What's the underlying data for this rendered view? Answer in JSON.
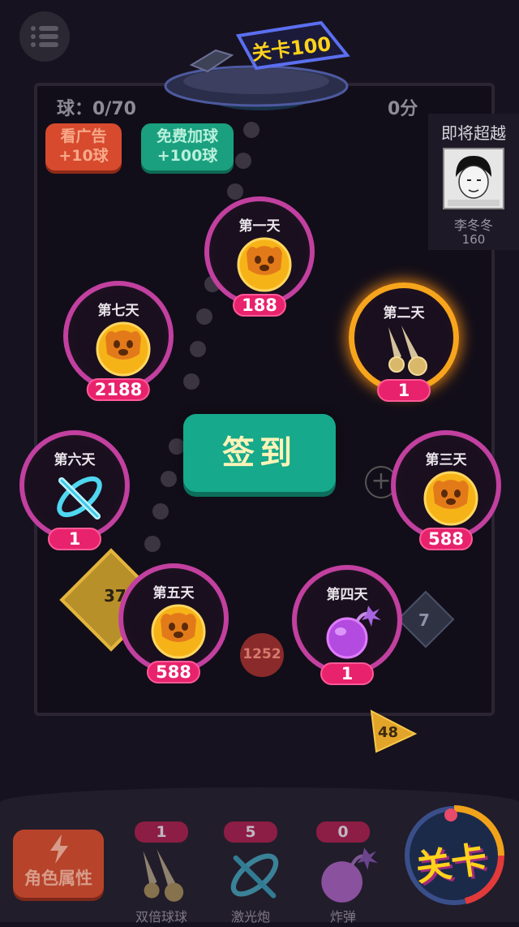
{
  "header": {
    "level_sign": "关卡100",
    "balls": "球：0/70",
    "score": "0分"
  },
  "actions": {
    "ad_line1": "看广告",
    "ad_line2": "+10球",
    "free_line1": "免费加球",
    "free_line2": "+100球"
  },
  "overtake": {
    "title": "即将超越",
    "name": "李冬冬",
    "score": "160"
  },
  "signin": {
    "button_label": "签到",
    "days": [
      {
        "label": "第一天",
        "reward": "188",
        "icon": "coin-face-icon"
      },
      {
        "label": "第二天",
        "reward": "1",
        "icon": "double-ball-icon",
        "highlighted": true
      },
      {
        "label": "第三天",
        "reward": "588",
        "icon": "coin-face-icon"
      },
      {
        "label": "第四天",
        "reward": "1",
        "icon": "bomb-icon"
      },
      {
        "label": "第五天",
        "reward": "588",
        "icon": "coin-face-icon"
      },
      {
        "label": "第六天",
        "reward": "1",
        "icon": "laser-icon"
      },
      {
        "label": "第七天",
        "reward": "2188",
        "icon": "coin-face-icon"
      }
    ]
  },
  "board_blocks": {
    "block_37": "37",
    "block_7": "7",
    "block_1252": "1252",
    "block_48": "48"
  },
  "bottom": {
    "attr_label": "角色属性",
    "tools": [
      {
        "count": "1",
        "label": "双倍球球",
        "icon": "double-ball-icon"
      },
      {
        "count": "5",
        "label": "激光炮",
        "icon": "laser-icon"
      },
      {
        "count": "0",
        "label": "炸弹",
        "icon": "bomb-icon"
      }
    ],
    "level_label": "关卡"
  },
  "colors": {
    "ring_pink": "#c2409f",
    "ring_gold": "#f7a51c",
    "reward_pill": "#e8226c",
    "signin_green": "#16a98b"
  }
}
